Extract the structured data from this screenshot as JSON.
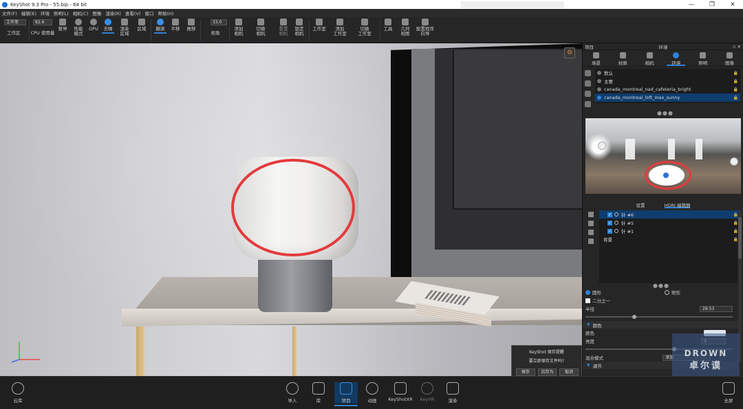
{
  "titlebar": {
    "title": "KeyShot 9.3 Pro  -  55.bip  -  64 bit",
    "minimize": "—",
    "maximize": "❐",
    "close": "✕"
  },
  "menu": [
    "文件(F)",
    "编辑(E)",
    "环境",
    "照明(L)",
    "相机(C)",
    "图像",
    "渲染(R)",
    "查看(V)",
    "窗口",
    "帮助(H)"
  ],
  "toolbar": {
    "workspace_select": "工作室",
    "workspace_label": "工作区",
    "cpu_value": "82.6",
    "cpu_label": "CPU 使用量",
    "pause": "暂停",
    "perf_mode": "性能\n模式",
    "gpu": "GPU",
    "denoise": "去噪",
    "render_area": "渲染\n区域",
    "region": "区域",
    "tumble": "翻滚",
    "pan": "平移",
    "dolly": "推移",
    "fov_value": "33.0",
    "fov_label": "视角",
    "add_camera": "添加\n相机",
    "switch_camera": "切换\n相机",
    "reset_camera": "重置\n相机",
    "lock_camera": "锁定\n相机",
    "studio": "工作室",
    "add_studio": "添加\n工作室",
    "switch_studio": "切换\n工作室",
    "tools": "工具",
    "geometry_view": "几何\n视图",
    "configurator": "配置程序\n向导"
  },
  "viewport": {
    "corner_icon": "camera-lock-icon"
  },
  "save_dialog": {
    "title": "KeyShot 保存提醒",
    "message": "要立即保存文件吗?",
    "save": "保存",
    "save_as": "另存为",
    "cancel": "取消"
  },
  "panel": {
    "left_label": "项目",
    "title": "环境",
    "tabs": [
      {
        "label": "场景",
        "icon": "scene-icon"
      },
      {
        "label": "材质",
        "icon": "material-icon"
      },
      {
        "label": "相机",
        "icon": "camera-icon"
      },
      {
        "label": "环境",
        "icon": "environment-icon"
      },
      {
        "label": "照明",
        "icon": "lighting-icon"
      },
      {
        "label": "图像",
        "icon": "image-icon"
      }
    ],
    "environments": [
      {
        "name": "默认"
      },
      {
        "name": "主要"
      },
      {
        "name": "canada_montreal_nad_cafeteria_bright"
      },
      {
        "name": "canada_montreal_loft_max_sunny"
      }
    ],
    "sub_tabs": {
      "settings": "设置",
      "hdri_editor": "HDRI 编辑器"
    },
    "lights": [
      {
        "name": "针 #6"
      },
      {
        "name": "针 #5"
      },
      {
        "name": "针 #1"
      }
    ],
    "background": "背景",
    "shape_circle": "圆形",
    "shape_rect": "矩形",
    "half": "二分之一",
    "radius_label": "半径",
    "radius_value": "28.53",
    "color_section": "颜色",
    "color_label": "颜色",
    "brightness_label": "亮度",
    "brightness_value": "3",
    "blend_label": "混合模式",
    "blend_value": "添加",
    "adjust_section": "调节"
  },
  "watermark": {
    "line1": "DROWN",
    "line2": "卓尔谟"
  },
  "bottombar": {
    "cloud": "云库",
    "import": "导入",
    "library": "库",
    "project": "项目",
    "animation": "动画",
    "keyshotxr": "KeyShotXR",
    "keyvr": "KeyVR",
    "render": "渲染",
    "fullscreen": "全屏"
  }
}
